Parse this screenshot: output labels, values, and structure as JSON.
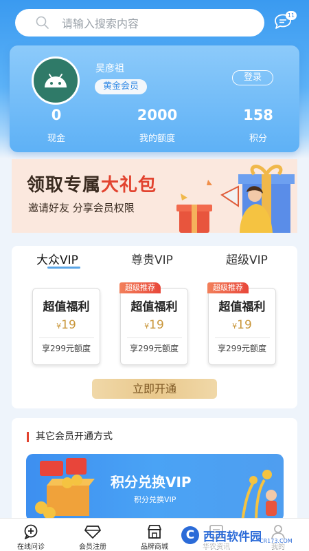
{
  "search": {
    "placeholder": "请输入搜索内容"
  },
  "messages": {
    "count": "11"
  },
  "profile": {
    "username": "吴彦祖",
    "level": "黄金会员",
    "login_label": "登录",
    "stats": [
      {
        "value": "0",
        "label": "现金"
      },
      {
        "value": "2000",
        "label": "我的额度"
      },
      {
        "value": "158",
        "label": "积分"
      }
    ]
  },
  "promo": {
    "title_normal": "领取专属",
    "title_highlight": "大礼包",
    "subtitle": "邀请好友 分享会员权限"
  },
  "vip": {
    "tabs": [
      "大众VIP",
      "尊贵VIP",
      "超级VIP"
    ],
    "plans": [
      {
        "badge": "",
        "name": "超值福利",
        "currency": "¥",
        "price": "19",
        "quota": "享299元额度"
      },
      {
        "badge": "超级推荐",
        "name": "超值福利",
        "currency": "¥",
        "price": "19",
        "quota": "享299元额度"
      },
      {
        "badge": "超级推荐",
        "name": "超值福利",
        "currency": "¥",
        "price": "19",
        "quota": "享299元额度"
      }
    ],
    "open_button": "立即开通"
  },
  "other": {
    "header": "其它会员开通方式",
    "banner_title": "积分兑换VIP",
    "banner_subtitle": "积分兑换VIP"
  },
  "bottom_nav": [
    {
      "label": "在线问诊",
      "icon": "chat-plus-icon"
    },
    {
      "label": "会员注册",
      "icon": "diamond-icon"
    },
    {
      "label": "品牌商城",
      "icon": "store-icon"
    },
    {
      "label": "华农资讯",
      "icon": "news-icon"
    },
    {
      "label": "我的",
      "icon": "user-icon"
    }
  ],
  "watermark": {
    "logo": "C",
    "text": "西西软件园",
    "domain": "CR173.COM"
  },
  "colors": {
    "accent": "#3a9af0",
    "highlight": "#e2432f",
    "gold": "#c9963a"
  }
}
